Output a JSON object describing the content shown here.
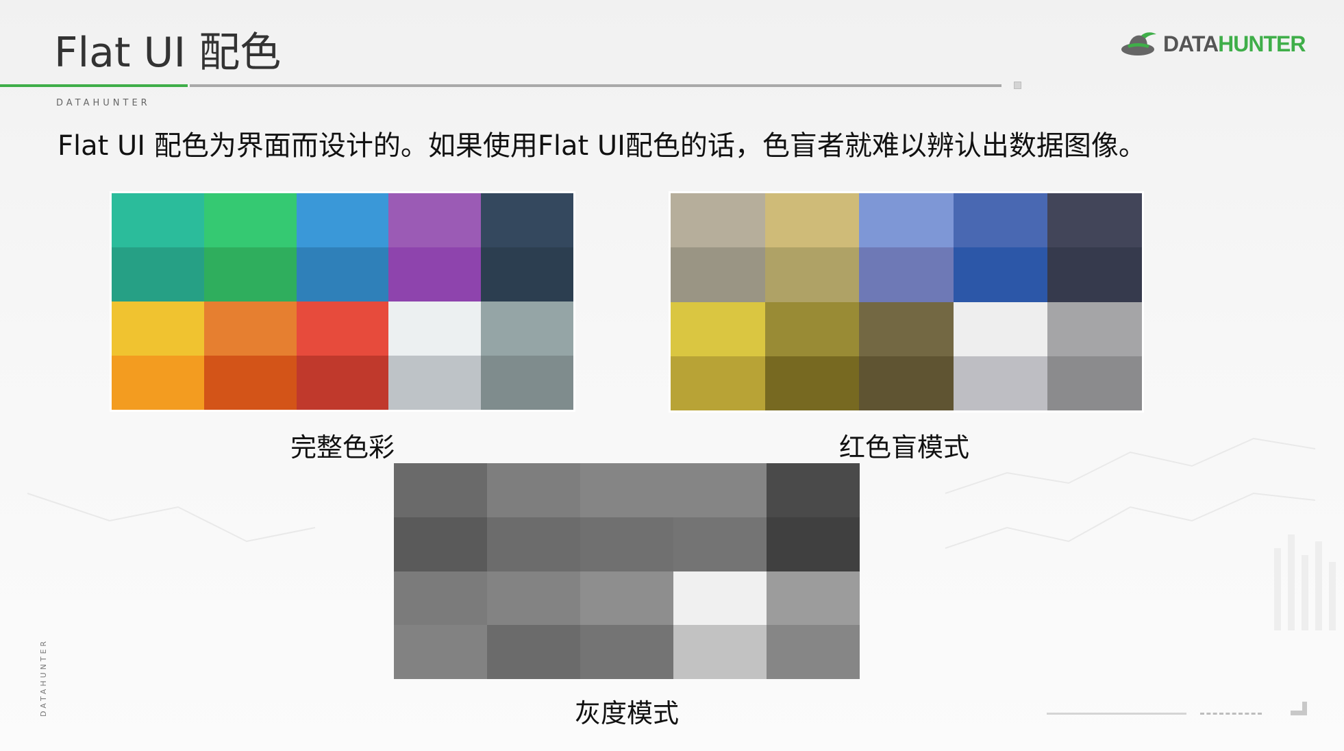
{
  "header": {
    "title": "Flat UI 配色",
    "brand_small": "DATAHUNTER",
    "logo": {
      "icon": "hat-icon",
      "text_part1": "DATA",
      "text_part2": "HUNTER"
    },
    "accent_color": "#3fae49"
  },
  "subtitle": "Flat UI 配色为界面而设计的。如果使用Flat UI配色的话，色盲者就难以辨认出数据图像。",
  "palettes": {
    "full": {
      "caption": "完整色彩",
      "colors": [
        "#2bbc9b",
        "#35c972",
        "#3a98d8",
        "#9b5bb5",
        "#34485e",
        "#26a085",
        "#2fae5d",
        "#2f80b9",
        "#8e44ad",
        "#2c3e50",
        "#f0c330",
        "#e67f30",
        "#e74b3c",
        "#ecf0f1",
        "#95a5a6",
        "#f39c20",
        "#d35418",
        "#c0392c",
        "#bec3c7",
        "#7f8c8d"
      ]
    },
    "protanopia": {
      "caption": "红色盲模式",
      "colors": [
        "#b6ae9b",
        "#cfbb78",
        "#7e97d6",
        "#4968b2",
        "#424559",
        "#9a9584",
        "#afa266",
        "#6e79b6",
        "#2c57a8",
        "#363a4d",
        "#dac641",
        "#998b35",
        "#736843",
        "#eeeeee",
        "#a5a5a7",
        "#b8a336",
        "#776921",
        "#5f5432",
        "#bebec3",
        "#8b8b8d"
      ]
    },
    "grayscale": {
      "caption": "灰度模式",
      "colors": [
        "#6a6a6a",
        "#7e7e7e",
        "#858585",
        "#858585",
        "#4a4a4a",
        "#5a5a5a",
        "#6c6c6c",
        "#707070",
        "#747474",
        "#404040",
        "#7b7b7b",
        "#838383",
        "#8e8e8e",
        "#f0f0f0",
        "#9c9c9c",
        "#828282",
        "#6b6b6b",
        "#747474",
        "#c2c2c2",
        "#868686"
      ]
    }
  },
  "footer": {
    "vertical_brand": "DATAHUNTER"
  }
}
